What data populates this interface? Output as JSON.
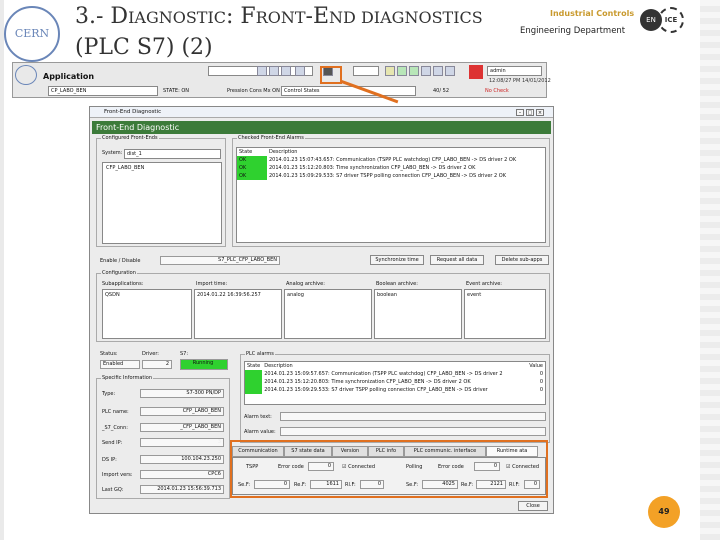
{
  "slide": {
    "title_line1_prefix": "3.- D",
    "title_line1_sc1": "IAGNOSTIC",
    "title_line1_mid": ": F",
    "title_line1_sc2": "RONT",
    "title_line1_mid2": "-E",
    "title_line1_sc3": "ND DIAGNOSTICS",
    "title_line2": "(PLC S7) (2)",
    "logo_text": "CERN",
    "industrial_controls": "Industrial Controls",
    "engineering_dept": "Engineering Department",
    "en_logo": "EN",
    "ice_logo": "ICE",
    "page_number": "49",
    "accent_color": "#e07020",
    "pagenum_color": "#f3a126"
  },
  "app": {
    "label": "Application",
    "field1": "CP_LABO_BEN",
    "state": "STATE: ON",
    "pressure": "Pression Cons Mx ON",
    "control": "Control States",
    "zoom": "40/ 52",
    "user": "admin",
    "datetime": "12:08/27 PM  14/01/2012",
    "check": "No Check"
  },
  "window": {
    "title": "Front-End Diagnostic",
    "header": "Front-End Diagnostic",
    "configured_legend": "Configured Front-Ends",
    "system_label": "System:",
    "system_value": "dist_1",
    "frontend_item": "CFP_LABO_BEN",
    "checked_legend": "Checked Front-End Alarms",
    "alarm_headers": [
      "State",
      "Description"
    ],
    "alarms": [
      {
        "state": "OK",
        "desc": "2014.01.23 15:07:43.657: Communication (TSPP PLC watchdog) CFP_LABO_BEN -> DS driver 2 OK"
      },
      {
        "state": "OK",
        "desc": "2014.01.23 15:12:20.803: Time synchronization CFP_LABO_BEN -> DS driver 2 OK"
      },
      {
        "state": "OK",
        "desc": "2014.01.23 15:09:29.533: S7 driver TSPP polling connection CFP_LABO_BEN -> DS driver 2 OK"
      }
    ],
    "enable_label": "Enable / Disable",
    "enable_value": "S7_PLC_CFP_LABO_BEN",
    "btn_sync": "Synchronize time",
    "btn_request": "Request all data",
    "btn_delete": "Delete sub-apps",
    "config_legend": "Configuration",
    "config_headers": [
      "Subapplications:",
      "Import time:",
      "Analog archive:",
      "Boolean archive:",
      "Event archive:"
    ],
    "config_values": [
      "QSDN",
      "2014.01.22 16:39:56.257",
      "analog",
      "boolean",
      "event"
    ],
    "status_label": "Status:",
    "status_value": "Enabled",
    "driver_label": "Driver:",
    "driver_value": "2",
    "s7_label": "S7:",
    "s7_value": "Running",
    "plc_alarms_legend": "PLC alarms",
    "plc_alarm_headers": [
      "State",
      "Description",
      "Value"
    ],
    "plc_alarms": [
      {
        "desc": "2014.01.23 15:09:57.657: Communication (TSPP PLC watchdog) CFP_LABO_BEN -> DS driver 2",
        "value": "0"
      },
      {
        "desc": "2014.01.23 15:12:20.803: Time synchronization CFP_LABO_BEN -> DS driver 2 OK",
        "value": "0"
      },
      {
        "desc": "2014.01.23 15:09:29.533: S7 driver TSPP polling connection CFP_LABO_BEN -> DS driver",
        "value": "0"
      }
    ],
    "alarm_text_label": "Alarm text:",
    "alarm_value_label": "Alarm value:",
    "specific_legend": "Specific Information",
    "spec": [
      {
        "label": "Type:",
        "value": "S7-300 PN/DP"
      },
      {
        "label": "PLC name:",
        "value": "CFP_LABO_BEN"
      },
      {
        "label": "_S7_Conn:",
        "value": "_CFP_LABO_BEN"
      },
      {
        "label": "Send IP:",
        "value": "3"
      },
      {
        "label": "DS IP:",
        "value": "100.104.23.250"
      },
      {
        "label": "Import vers:",
        "value": "CPC6"
      },
      {
        "label": "Last GQ:",
        "value": "2014.01.23 15:56:39.713"
      }
    ],
    "tabs": [
      "Communication",
      "S7 state data",
      "Version",
      "PLC info",
      "PLC communic. interface",
      "Runtime ata"
    ],
    "tspp_label": "TSPP",
    "tspp_err_label": "Error code",
    "tspp_err": "0",
    "tspp_conn": "Connected",
    "polling_label": "Polling",
    "polling_err_label": "Error code",
    "polling_err": "0",
    "polling_conn": "Connected",
    "row3": [
      {
        "label": "Se.F:",
        "value": "0"
      },
      {
        "label": "Re.F:",
        "value": "1611"
      },
      {
        "label": "Rl.F:",
        "value": "0"
      },
      {
        "label": "Se.F:",
        "value": "4025"
      },
      {
        "label": "Re.F:",
        "value": "2121"
      },
      {
        "label": "Rl.F:",
        "value": "0"
      }
    ],
    "close": "Close"
  }
}
